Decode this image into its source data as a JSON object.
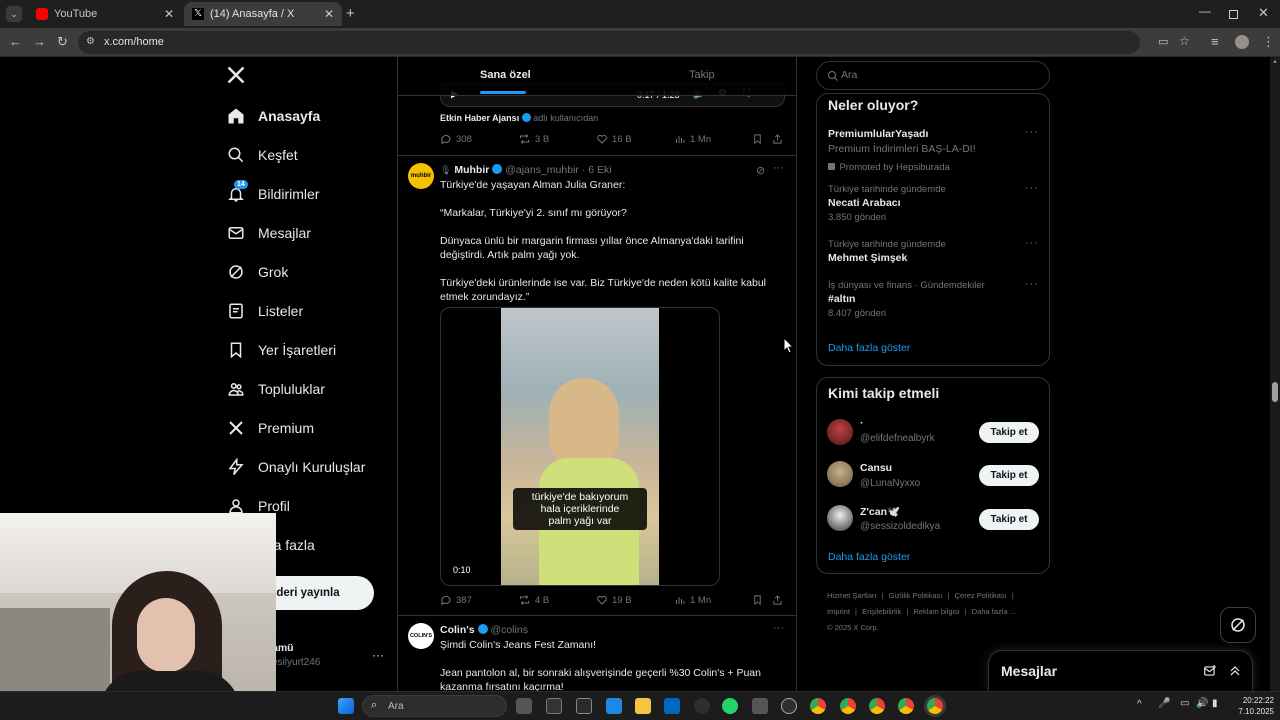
{
  "browser": {
    "tabs": [
      {
        "title": "YouTube"
      },
      {
        "title": "(14) Anasayfa / X"
      }
    ],
    "url": "x.com/home"
  },
  "nav": {
    "items": [
      {
        "label": "Anasayfa",
        "icon": "home-icon"
      },
      {
        "label": "Keşfet",
        "icon": "search-icon"
      },
      {
        "label": "Bildirimler",
        "icon": "bell-icon",
        "badge": "14"
      },
      {
        "label": "Mesajlar",
        "icon": "mail-icon"
      },
      {
        "label": "Grok",
        "icon": "grok-icon"
      },
      {
        "label": "Listeler",
        "icon": "list-icon"
      },
      {
        "label": "Yer İşaretleri",
        "icon": "bookmark-icon"
      },
      {
        "label": "Topluluklar",
        "icon": "community-icon"
      },
      {
        "label": "Premium",
        "icon": "x-icon"
      },
      {
        "label": "Onaylı Kuruluşlar",
        "icon": "lightning-icon"
      },
      {
        "label": "Profil",
        "icon": "person-icon"
      },
      {
        "label": "aha fazla",
        "icon": "more-icon"
      }
    ],
    "post_button": "deri yayınla",
    "account_name": "amü",
    "account_handle": "esilyurt246"
  },
  "feed": {
    "tabs": [
      "Sana özel",
      "Takip"
    ],
    "prev_tweet": {
      "video_time": "0:17 / 1:23",
      "source_name": "Etkin Haber Ajansı",
      "source_suffix": "adlı kullanıcıdan",
      "replies": "308",
      "reposts": "3 B",
      "likes": "16 B",
      "views": "1 Mn"
    },
    "tweet1": {
      "avatar_text": "muhbir",
      "name": "Muhbir",
      "handle": "@ajans_muhbir",
      "date": "· 6 Eki",
      "text": "Türkiye'de yaşayan Alman Julia Graner:\n\n“Markalar, Türkiye'yi 2. sınıf mı görüyor?\n\nDünyaca ünlü bir margarin firması yıllar önce Almanya'daki tarifini değiştirdi. Artık palm yağı yok.\n\nTürkiye'deki ürünlerinde ise var. Biz Türkiye'de neden kötü kalite kabul etmek zorundayız.”",
      "video_caption": "türkiye'de bakıyorum\nhala içeriklerinde\npalm yağı var",
      "video_duration": "0:10",
      "replies": "387",
      "reposts": "4 B",
      "likes": "19 B",
      "views": "1 Mn"
    },
    "tweet2": {
      "avatar_text": "COLIN'S",
      "name": "Colin's",
      "handle": "@colins",
      "line1": "Şimdi Colin's Jeans Fest Zamanı!",
      "line2": "Jean pantolon al, bir sonraki alışverişinde geçerli %30 Colin's + Puan kazanma fırsatını kaçırma!"
    }
  },
  "right": {
    "search_placeholder": "Ara",
    "trends_title": "Neler oluyor?",
    "trends": [
      {
        "context": "",
        "title": "PremiumlularYaşadı",
        "sub": "Premium İndirimleri BAŞ-LA-DI!",
        "meta": "Promoted by Hepsiburada"
      },
      {
        "context": "Türkiye tarihinde gündemde",
        "title": "Necati Arabacı",
        "meta": "3.850 gönderi"
      },
      {
        "context": "Türkiye tarihinde gündemde",
        "title": "Mehmet Şimşek",
        "meta": ""
      },
      {
        "context": "İş dünyası ve finans · Gündemdekiler",
        "title": "#altın",
        "meta": "8.407 gönderi"
      }
    ],
    "trends_more": "Daha fazla göster",
    "follow_title": "Kimi takip etmeli",
    "follows": [
      {
        "name": "·",
        "handle": "@elifdefnealbyrk",
        "button": "Takip et"
      },
      {
        "name": "Cansu",
        "handle": "@LunaNyxxo",
        "button": "Takip et"
      },
      {
        "name": "Z'can🕊️",
        "handle": "@sessizoldedikya",
        "button": "Takip et"
      }
    ],
    "follow_more": "Daha fazla göster",
    "footer1": [
      "Hizmet Şartları",
      "Gizlilik Politikası",
      "Çerez Politikası"
    ],
    "footer2": [
      "Imprint",
      "Erişilebilirlik",
      "Reklam bilgisi",
      "Daha fazla ..."
    ],
    "copyright": "© 2025 X Corp."
  },
  "messages_drawer": {
    "title": "Mesajlar"
  },
  "taskbar": {
    "search_placeholder": "Ara",
    "time": "20:22:22",
    "date": "7.10.2025"
  }
}
